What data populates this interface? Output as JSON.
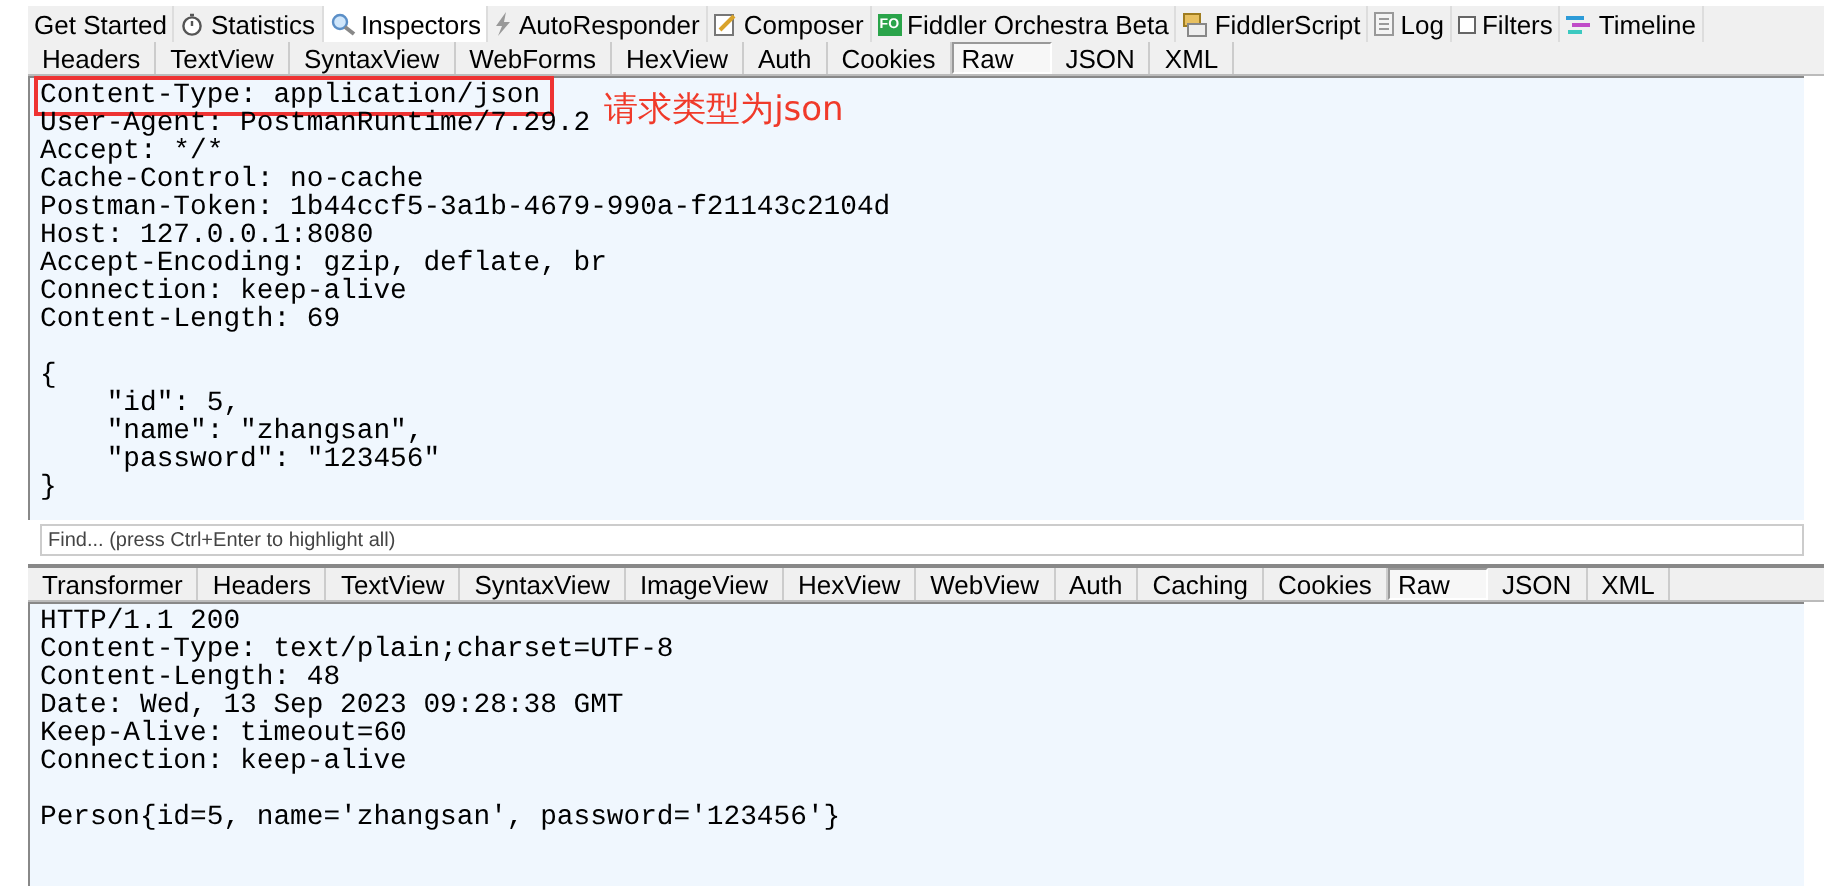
{
  "main_tabs": [
    {
      "label": "Get Started",
      "selected": false
    },
    {
      "label": "Statistics",
      "selected": false
    },
    {
      "label": "Inspectors",
      "selected": true
    },
    {
      "label": "AutoResponder",
      "selected": false
    },
    {
      "label": "Composer",
      "selected": false
    },
    {
      "label": "Fiddler Orchestra Beta",
      "badge": "FO",
      "selected": false
    },
    {
      "label": "FiddlerScript",
      "selected": false
    },
    {
      "label": "Log",
      "selected": false
    },
    {
      "label": "Filters",
      "checked": false,
      "selected": false
    },
    {
      "label": "Timeline",
      "selected": false
    }
  ],
  "request": {
    "tabs": [
      {
        "label": "Headers",
        "selected": false
      },
      {
        "label": "TextView",
        "selected": false
      },
      {
        "label": "SyntaxView",
        "selected": false
      },
      {
        "label": "WebForms",
        "selected": false
      },
      {
        "label": "HexView",
        "selected": false
      },
      {
        "label": "Auth",
        "selected": false
      },
      {
        "label": "Cookies",
        "selected": false
      },
      {
        "label": "Raw",
        "selected": true
      },
      {
        "label": "JSON",
        "selected": false
      },
      {
        "label": "XML",
        "selected": false
      }
    ],
    "sections": [
      {
        "lines": [
          {
            "text": "Content-Type: application/json",
            "highlighted": true,
            "note": "请求类型为json"
          },
          {
            "text": "User-Agent: PostmanRuntime/7.29.2"
          },
          {
            "text": "Accept: */*"
          },
          {
            "text": "Cache-Control: no-cache"
          },
          {
            "text": "Postman-Token: 1b44ccf5-3a1b-4679-990a-f21143c2104d"
          },
          {
            "text": "Host: 127.0.0.1:8080"
          },
          {
            "text": "Accept-Encoding: gzip, deflate, br"
          },
          {
            "text": "Connection: keep-alive"
          },
          {
            "text": "Content-Length: 69"
          }
        ]
      },
      {
        "lines": [
          {
            "text": "{"
          },
          {
            "text": "    \"id\": 5,"
          },
          {
            "text": "    \"name\": \"zhangsan\","
          },
          {
            "text": "    \"password\": \"123456\""
          },
          {
            "text": "}"
          }
        ]
      }
    ],
    "find_placeholder": "Find... (press Ctrl+Enter to highlight all)"
  },
  "response": {
    "tabs": [
      {
        "label": "Transformer",
        "selected": false
      },
      {
        "label": "Headers",
        "selected": false
      },
      {
        "label": "TextView",
        "selected": false
      },
      {
        "label": "SyntaxView",
        "selected": false
      },
      {
        "label": "ImageView",
        "selected": false
      },
      {
        "label": "HexView",
        "selected": false
      },
      {
        "label": "WebView",
        "selected": false
      },
      {
        "label": "Auth",
        "selected": false
      },
      {
        "label": "Caching",
        "selected": false
      },
      {
        "label": "Cookies",
        "selected": false
      },
      {
        "label": "Raw",
        "selected": true
      },
      {
        "label": "JSON",
        "selected": false
      },
      {
        "label": "XML",
        "selected": false
      }
    ],
    "sections": [
      {
        "lines": [
          {
            "text": "HTTP/1.1 200"
          },
          {
            "text": "Content-Type: text/plain;charset=UTF-8"
          },
          {
            "text": "Content-Length: 48"
          },
          {
            "text": "Date: Wed, 13 Sep 2023 09:28:38 GMT"
          },
          {
            "text": "Keep-Alive: timeout=60"
          },
          {
            "text": "Connection: keep-alive"
          }
        ]
      },
      {
        "lines": [
          {
            "text": "Person{id=5, name='zhangsan', password='123456'}"
          }
        ]
      }
    ]
  }
}
